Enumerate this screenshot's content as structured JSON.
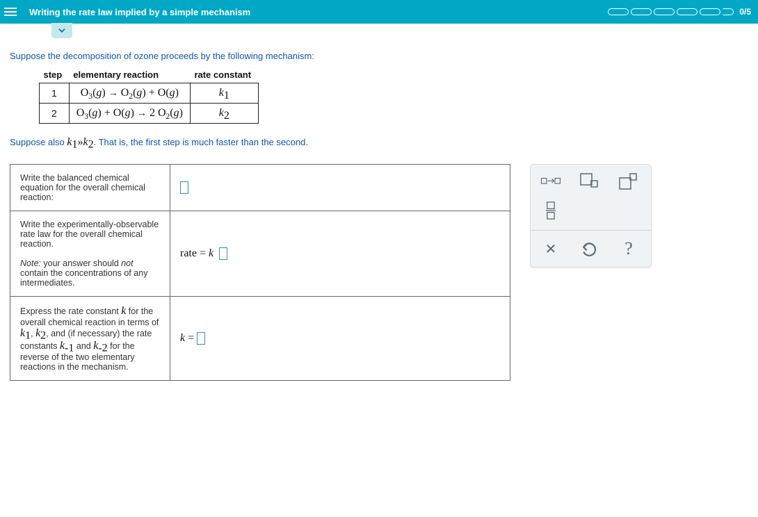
{
  "header": {
    "title": "Writing the rate law implied by a simple mechanism",
    "score": "0/5"
  },
  "intro": "Suppose the decomposition of ozone proceeds by the following mechanism:",
  "mech_headers": {
    "step": "step",
    "reaction": "elementary reaction",
    "rate": "rate constant"
  },
  "mech": {
    "row1": {
      "step": "1",
      "lhs": "O",
      "k": "k"
    },
    "row2": {
      "step": "2",
      "k": "k"
    }
  },
  "suppose2_a": "Suppose also ",
  "suppose2_b": ". That is, the first step is much faster than the second.",
  "qa": {
    "r1_left": "Write the balanced chemical equation for the overall chemical reaction:",
    "r2_left_a": "Write the experimentally-observable rate law for the overall chemical reaction.",
    "r2_note_label": "Note:",
    "r2_note_body": " your answer should ",
    "r2_note_not": "not",
    "r2_note_tail": " contain the concentrations of any intermediates.",
    "r2_right_prefix": "rate = ",
    "r2_right_k": "k",
    "r3_left_a": "Express the rate constant ",
    "r3_left_k": "k",
    "r3_left_b": " for the overall chemical reaction in terms of ",
    "r3_left_c": ", and (if necessary) the rate constants ",
    "r3_left_d": " for the reverse of the two elementary reactions in the mechanism.",
    "r3_right_prefix": "k",
    "r3_right_eq": " = "
  },
  "palette": {
    "help": "?"
  }
}
